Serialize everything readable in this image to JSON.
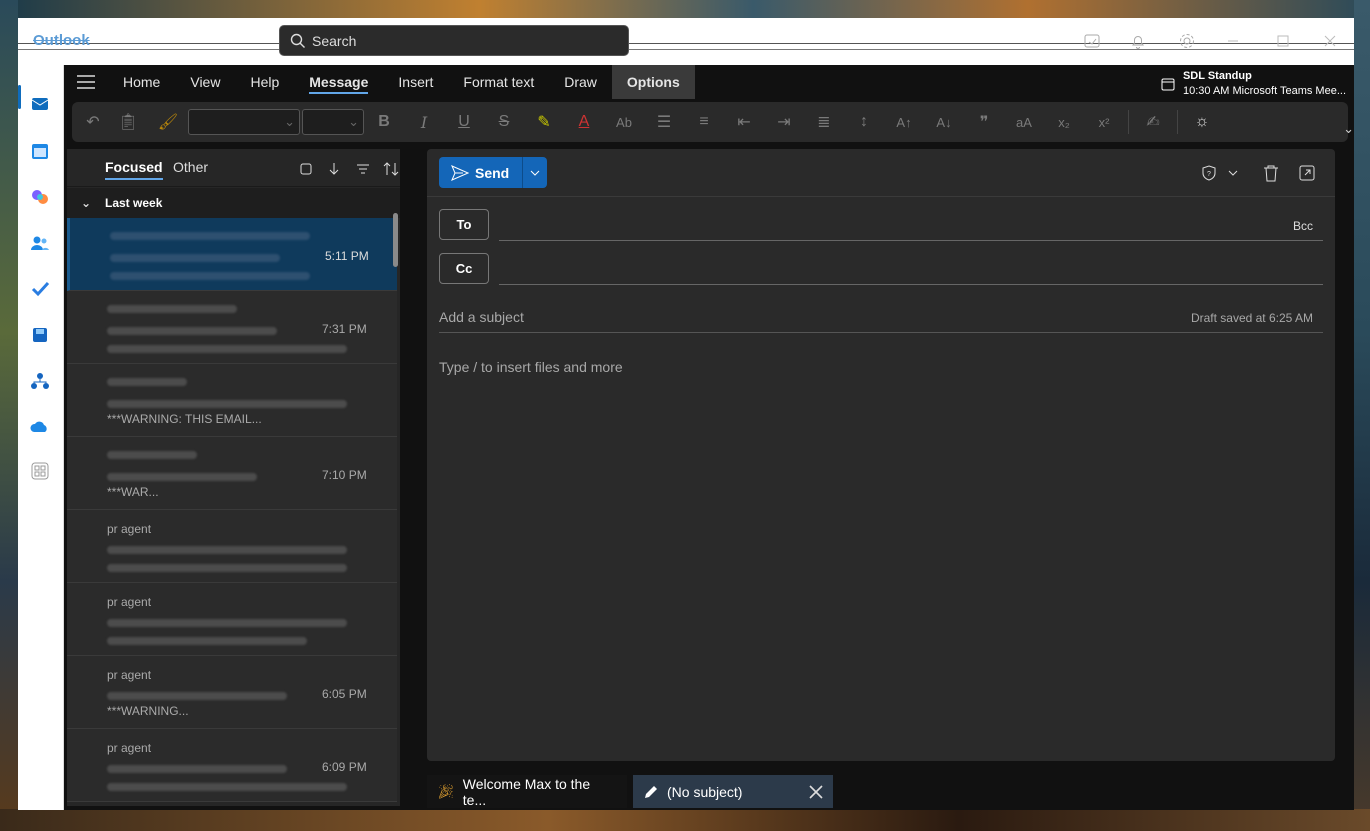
{
  "app": {
    "title": "Outlook"
  },
  "search": {
    "placeholder": "Search"
  },
  "tabs": [
    "Home",
    "View",
    "Help",
    "Message",
    "Insert",
    "Format text",
    "Draw",
    "Options"
  ],
  "meeting": {
    "title": "SDL Standup",
    "detail": "10:30 AM Microsoft Teams Mee..."
  },
  "list": {
    "focused": "Focused",
    "other": "Other",
    "group": "Last week",
    "items": [
      {
        "sender": "",
        "time": "5:11 PM",
        "preview": ""
      },
      {
        "sender": "",
        "time": "7:31 PM",
        "preview": ""
      },
      {
        "sender": "",
        "time": "",
        "preview": "***WARNING: THIS EMAIL..."
      },
      {
        "sender": "",
        "time": "7:10 PM",
        "preview": "***WAR..."
      },
      {
        "sender": "pr agent",
        "time": "",
        "preview": ""
      },
      {
        "sender": "pr agent",
        "time": "",
        "preview": ""
      },
      {
        "sender": "pr agent",
        "time": "6:05 PM",
        "preview": "***WARNING..."
      },
      {
        "sender": "pr agent",
        "time": "6:09 PM",
        "preview": ""
      }
    ]
  },
  "compose": {
    "send": "Send",
    "to": "To",
    "cc": "Cc",
    "bcc": "Bcc",
    "subject_placeholder": "Add a subject",
    "draft_status": "Draft saved at 6:25 AM",
    "body_placeholder": "Type / to insert files and more"
  },
  "bottom_tabs": [
    {
      "label": "Welcome Max to the te..."
    },
    {
      "label": "(No subject)"
    }
  ],
  "colors": {
    "accent": "#0f6cbd",
    "send": "#1466b8",
    "dark_bg": "#111111",
    "pane": "#2a2a2a"
  }
}
